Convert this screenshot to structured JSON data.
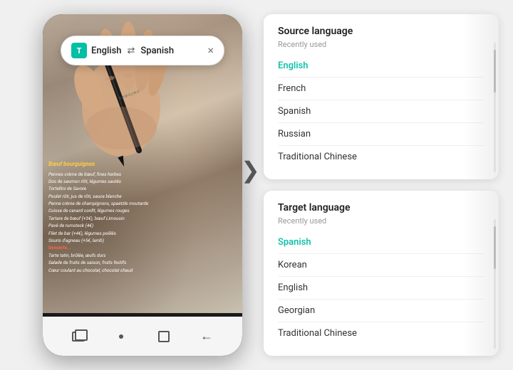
{
  "phone": {
    "translation_bar": {
      "icon_label": "T",
      "source_lang": "English",
      "swap_symbol": "⇄",
      "target_lang": "Spanish",
      "close_symbol": "×"
    },
    "nav": {
      "dot": "•",
      "recents_label": "recents",
      "home_label": "home",
      "back_label": "back"
    },
    "menu": {
      "title1": "Bœuf bourguignon",
      "items": [
        "Pennes crème de bœuf, fines herbes",
        "Dos de saumon rôti, légumes sautés",
        "Tortellini de Savoie",
        "Poulet rôti, jus de rôti, sauce blanche",
        "Penne crème de champignons, spaetzle moutarde",
        "Cuisse de canard confit, légumes rouges",
        "Tartare de bœuf (+3€), bœuf Limousin",
        "Pavé de rumsteck (4€)",
        "Filet de bar (+4€), légumes poêlés",
        "Souris d'agneau (+5€, lamb)"
      ],
      "title2": "Desserts",
      "desserts": [
        "Tarte tatin, brûlée, œufs durs",
        "Salade de fruits de saison, fruits festifs",
        "Cœur coulant au chocolat, chocolat chaud"
      ],
      "red_item": "Desserts..."
    }
  },
  "source_panel": {
    "title": "Source language",
    "subtitle": "Recently used",
    "items": [
      {
        "label": "English",
        "selected": true
      },
      {
        "label": "French",
        "selected": false
      },
      {
        "label": "Spanish",
        "selected": false
      },
      {
        "label": "Russian",
        "selected": false
      },
      {
        "label": "Traditional Chinese",
        "selected": false
      }
    ]
  },
  "target_panel": {
    "title": "Target language",
    "subtitle": "Recently used",
    "items": [
      {
        "label": "Spanish",
        "selected": true
      },
      {
        "label": "Korean",
        "selected": false
      },
      {
        "label": "English",
        "selected": false
      },
      {
        "label": "Georgian",
        "selected": false
      },
      {
        "label": "Traditional Chinese",
        "selected": false
      }
    ]
  },
  "arrow": "❯",
  "colors": {
    "accent": "#00bfa5",
    "text_primary": "#212121",
    "text_secondary": "#757575"
  }
}
